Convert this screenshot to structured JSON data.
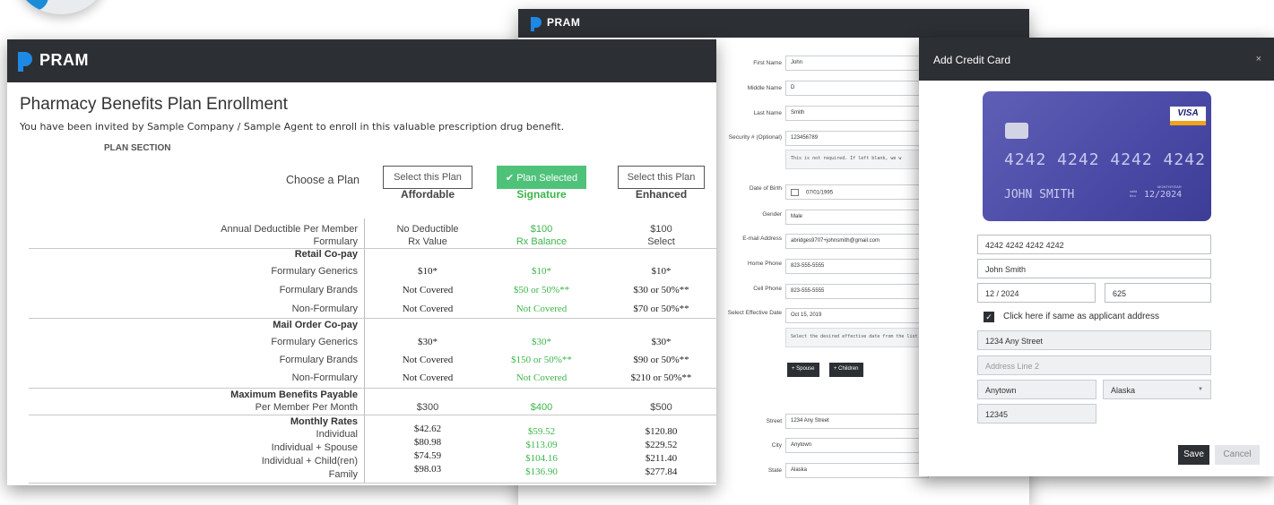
{
  "brand": {
    "name": "PRAM"
  },
  "enrollment": {
    "title": "Pharmacy Benefits Plan Enrollment",
    "subtitle": "You have been invited by Sample Company / Sample Agent to enroll in this valuable prescription drug benefit.",
    "section_label": "PLAN SECTION",
    "choose_label": "Choose a Plan",
    "plans": [
      {
        "button": "Select this Plan",
        "name": "Affordable",
        "selected": false
      },
      {
        "button": "Plan Selected",
        "name": "Signature",
        "selected": true
      },
      {
        "button": "Select this Plan",
        "name": "Enhanced",
        "selected": false
      }
    ],
    "rows": [
      {
        "label": "Annual Deductible Per Member",
        "values": [
          "No Deductible",
          "$100",
          "$100"
        ]
      },
      {
        "label": "Formulary",
        "values": [
          "Rx Value",
          "Rx Balance",
          "Select"
        ]
      },
      {
        "label": "Retail Co-pay",
        "header": true
      },
      {
        "label": "Formulary Generics",
        "values": [
          "$10*",
          "$10*",
          "$10*"
        ]
      },
      {
        "label": "Formulary Brands",
        "values": [
          "Not Covered",
          "$50 or 50%**",
          "$30 or 50%**"
        ]
      },
      {
        "label": "Non-Formulary",
        "values": [
          "Not Covered",
          "Not Covered",
          "$70 or 50%**"
        ]
      },
      {
        "label": "Mail Order Co-pay",
        "header": true
      },
      {
        "label": "Formulary Generics",
        "values": [
          "$30*",
          "$30*",
          "$30*"
        ]
      },
      {
        "label": "Formulary Brands",
        "values": [
          "Not Covered",
          "$150 or 50%**",
          "$90 or 50%**"
        ]
      },
      {
        "label": "Non-Formulary",
        "values": [
          "Not Covered",
          "Not Covered",
          "$210 or 50%**"
        ]
      },
      {
        "label": "Maximum Benefits Payable",
        "header": true
      },
      {
        "label": "Per Member Per Month",
        "values": [
          "$300",
          "$400",
          "$500"
        ]
      },
      {
        "label": "Monthly Rates",
        "header": true
      },
      {
        "label": "Individual",
        "values": [
          "$42.62",
          "$59.52",
          "$120.80"
        ]
      },
      {
        "label": "Individual + Spouse",
        "values": [
          "$80.98",
          "$113.09",
          "$229.52"
        ]
      },
      {
        "label": "Individual + Child(ren)",
        "values": [
          "$74.59",
          "$104.16",
          "$211.40"
        ]
      },
      {
        "label": "Family",
        "values": [
          "$98.03",
          "$136.90",
          "$277.84"
        ]
      }
    ]
  },
  "applicant": {
    "fields": [
      {
        "label": "First Name",
        "value": "John"
      },
      {
        "label": "Middle Name",
        "value": "D"
      },
      {
        "label": "Last Name",
        "value": "Smith"
      },
      {
        "label": "Security # (Optional)",
        "value": "123456789"
      },
      {
        "label": "",
        "value": "This is not required. If left blank, we w"
      },
      {
        "label": "Date of Birth",
        "value": "07/01/1995"
      },
      {
        "label": "Gender",
        "value": "Male"
      },
      {
        "label": "E-mail Address",
        "value": "abridges9707+johnsmith@gmail.com"
      },
      {
        "label": "Home Phone",
        "value": "823-555-5555"
      },
      {
        "label": "Cell Phone",
        "value": "823-555-5555"
      },
      {
        "label": "Select Effective Date",
        "value": "Oct 15, 2019"
      },
      {
        "label": "",
        "value": "Select the desired effective date from the list"
      },
      {
        "label": "Street",
        "value": "1234 Any Street"
      },
      {
        "label": "City",
        "value": "Anytown"
      },
      {
        "label": "State",
        "value": "Alaska"
      }
    ],
    "spouse_button": "+ Spouse",
    "children_button": "+ Children"
  },
  "credit_card": {
    "modal_title": "Add Credit Card",
    "close": "×",
    "card": {
      "brand": "VISA",
      "number": "4242 4242 4242 4242",
      "holder": "JOHN SMITH",
      "valid_thru": "valid\nthru",
      "month_year": "MONTH/YEAR",
      "expiry": "12/2024"
    },
    "fields": {
      "number": "4242 4242 4242 4242",
      "name": "John Smith",
      "expiry": "12 / 2024",
      "cvc": "625",
      "same_address_label": "Click here if same as applicant address",
      "address1": "1234 Any Street",
      "address2_placeholder": "Address Line 2",
      "city": "Anytown",
      "state": "Alaska",
      "zip": "12345"
    },
    "save_button": "Save",
    "cancel_button": "Cancel"
  },
  "colors": {
    "header_bar": "#2c2f33",
    "brand_blue": "#1e88e5",
    "selected_green": "#4fc27a",
    "card_purple": "#4f4fa9"
  },
  "icons": [
    "pram-logo-icon",
    "check-icon",
    "calendar-icon",
    "close-icon",
    "chevron-down-icon",
    "checkbox-checked-icon"
  ]
}
